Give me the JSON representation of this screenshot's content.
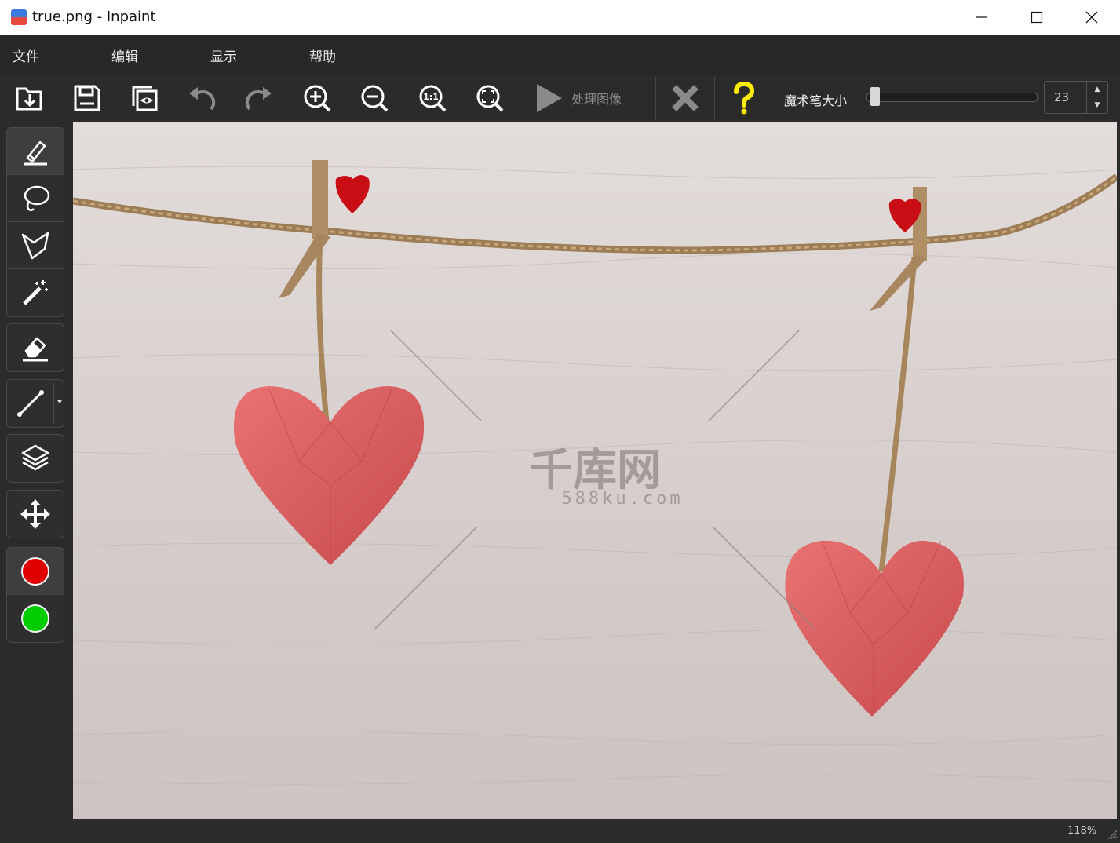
{
  "window": {
    "title": "true.png - Inpaint",
    "controls": {
      "minimize_icon": "minimize-icon",
      "maximize_icon": "maximize-icon",
      "close_icon": "close-icon"
    }
  },
  "menu": [
    "文件",
    "编辑",
    "显示",
    "帮助"
  ],
  "toolbar": {
    "buttons": [
      "open-icon",
      "save-icon",
      "preview-icon",
      "undo-icon",
      "redo-icon",
      "zoom-in-icon",
      "zoom-out-icon",
      "zoom-actual-size-icon",
      "zoom-fit-icon"
    ],
    "process_label": "处理图像",
    "magic_wand_label": "魔术笔大小",
    "magic_wand_size": "23",
    "magic_wand_size_value": 23
  },
  "left_tools": {
    "selection_tools": [
      "marker-icon",
      "lasso-icon",
      "polygon-lasso-icon",
      "magic-wand-icon"
    ],
    "eraser": "eraser-icon",
    "line": "line-icon",
    "layers": "layers-icon",
    "move": "move-icon",
    "colors": {
      "mask": "#e00000",
      "donor": "#00cc00"
    }
  },
  "canvas": {
    "watermark_brand": "千库网",
    "watermark_url": "588ku.com"
  },
  "status": {
    "zoom": "118%"
  }
}
